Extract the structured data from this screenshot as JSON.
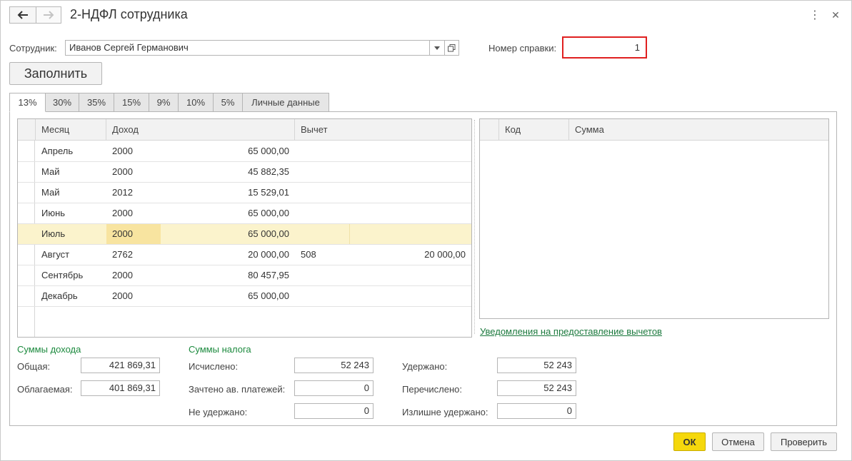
{
  "window": {
    "title": "2-НДФЛ сотрудника"
  },
  "header": {
    "back_icon": "arrow-left-icon",
    "forward_icon": "arrow-right-icon",
    "more_icon": "⋮",
    "close_icon": "✕"
  },
  "employee": {
    "label": "Сотрудник:",
    "value": "Иванов Сергей Германович"
  },
  "certificate": {
    "label": "Номер справки:",
    "value": "1",
    "highlight_color": "#e02020"
  },
  "fill_button": "Заполнить",
  "tabs": [
    {
      "label": "13%",
      "active": true
    },
    {
      "label": "30%"
    },
    {
      "label": "35%"
    },
    {
      "label": "15%"
    },
    {
      "label": "9%"
    },
    {
      "label": "10%"
    },
    {
      "label": "5%"
    },
    {
      "label": "Личные данные"
    }
  ],
  "income_table": {
    "headers": {
      "month": "Месяц",
      "income": "Доход",
      "deduction": "Вычет"
    },
    "rows": [
      {
        "month": "Апрель",
        "code": "2000",
        "amount": "65 000,00",
        "ded_code": "",
        "ded_amount": ""
      },
      {
        "month": "Май",
        "code": "2000",
        "amount": "45 882,35",
        "ded_code": "",
        "ded_amount": ""
      },
      {
        "month": "Май",
        "code": "2012",
        "amount": "15 529,01",
        "ded_code": "",
        "ded_amount": ""
      },
      {
        "month": "Июнь",
        "code": "2000",
        "amount": "65 000,00",
        "ded_code": "",
        "ded_amount": ""
      },
      {
        "month": "Июль",
        "code": "2000",
        "amount": "65 000,00",
        "ded_code": "",
        "ded_amount": "",
        "selected": true
      },
      {
        "month": "Август",
        "code": "2762",
        "amount": "20 000,00",
        "ded_code": "508",
        "ded_amount": "20 000,00"
      },
      {
        "month": "Сентябрь",
        "code": "2000",
        "amount": "80 457,95",
        "ded_code": "",
        "ded_amount": ""
      },
      {
        "month": "Декабрь",
        "code": "2000",
        "amount": "65 000,00",
        "ded_code": "",
        "ded_amount": ""
      }
    ]
  },
  "deductions_table": {
    "headers": {
      "code": "Код",
      "sum": "Сумма"
    }
  },
  "notifications_link": "Уведомления на предоставление вычетов",
  "income_sums": {
    "title": "Суммы дохода",
    "total_label": "Общая:",
    "total_value": "421 869,31",
    "taxable_label": "Облагаемая:",
    "taxable_value": "401 869,31"
  },
  "tax_sums": {
    "title": "Суммы налога",
    "calculated_label": "Исчислено:",
    "calculated_value": "52 243",
    "advance_label": "Зачтено ав. платежей:",
    "advance_value": "0",
    "not_withheld_label": "Не удержано:",
    "not_withheld_value": "0",
    "withheld_label": "Удержано:",
    "withheld_value": "52 243",
    "transferred_label": "Перечислено:",
    "transferred_value": "52 243",
    "excess_label": "Излишне удержано:",
    "excess_value": "0"
  },
  "footer": {
    "ok": "ОК",
    "cancel": "Отмена",
    "check": "Проверить"
  }
}
